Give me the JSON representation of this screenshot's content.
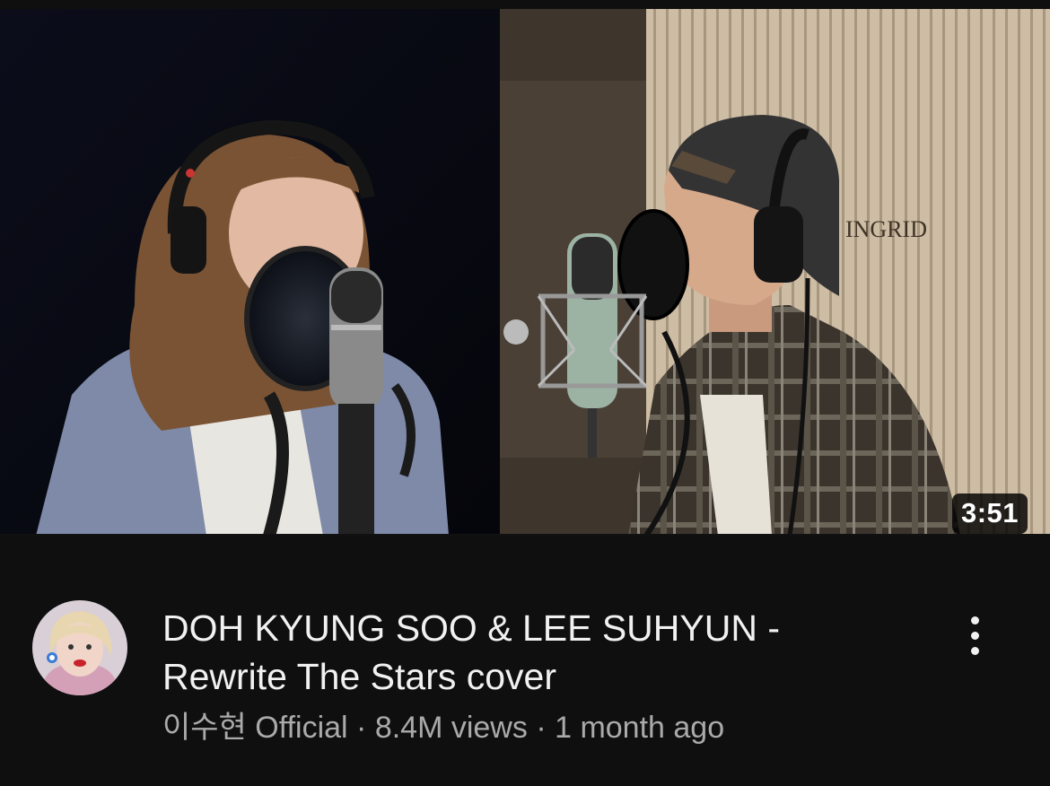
{
  "video": {
    "duration": "3:51",
    "title_line1": "DOH KYUNG SOO & LEE SUHYUN -",
    "title_line2": "Rewrite The Stars cover",
    "channel": "이수현 Official",
    "separator": " · ",
    "views": "8.4M views",
    "age": "1 month ago",
    "studio_sign": "INGRID"
  },
  "icons": {
    "menu": "vertical-ellipsis-icon",
    "avatar": "channel-avatar"
  },
  "colors": {
    "background": "#0f0f0f",
    "title": "#f1f1f1",
    "meta": "#aaaaaa",
    "badge_bg": "#000000"
  }
}
